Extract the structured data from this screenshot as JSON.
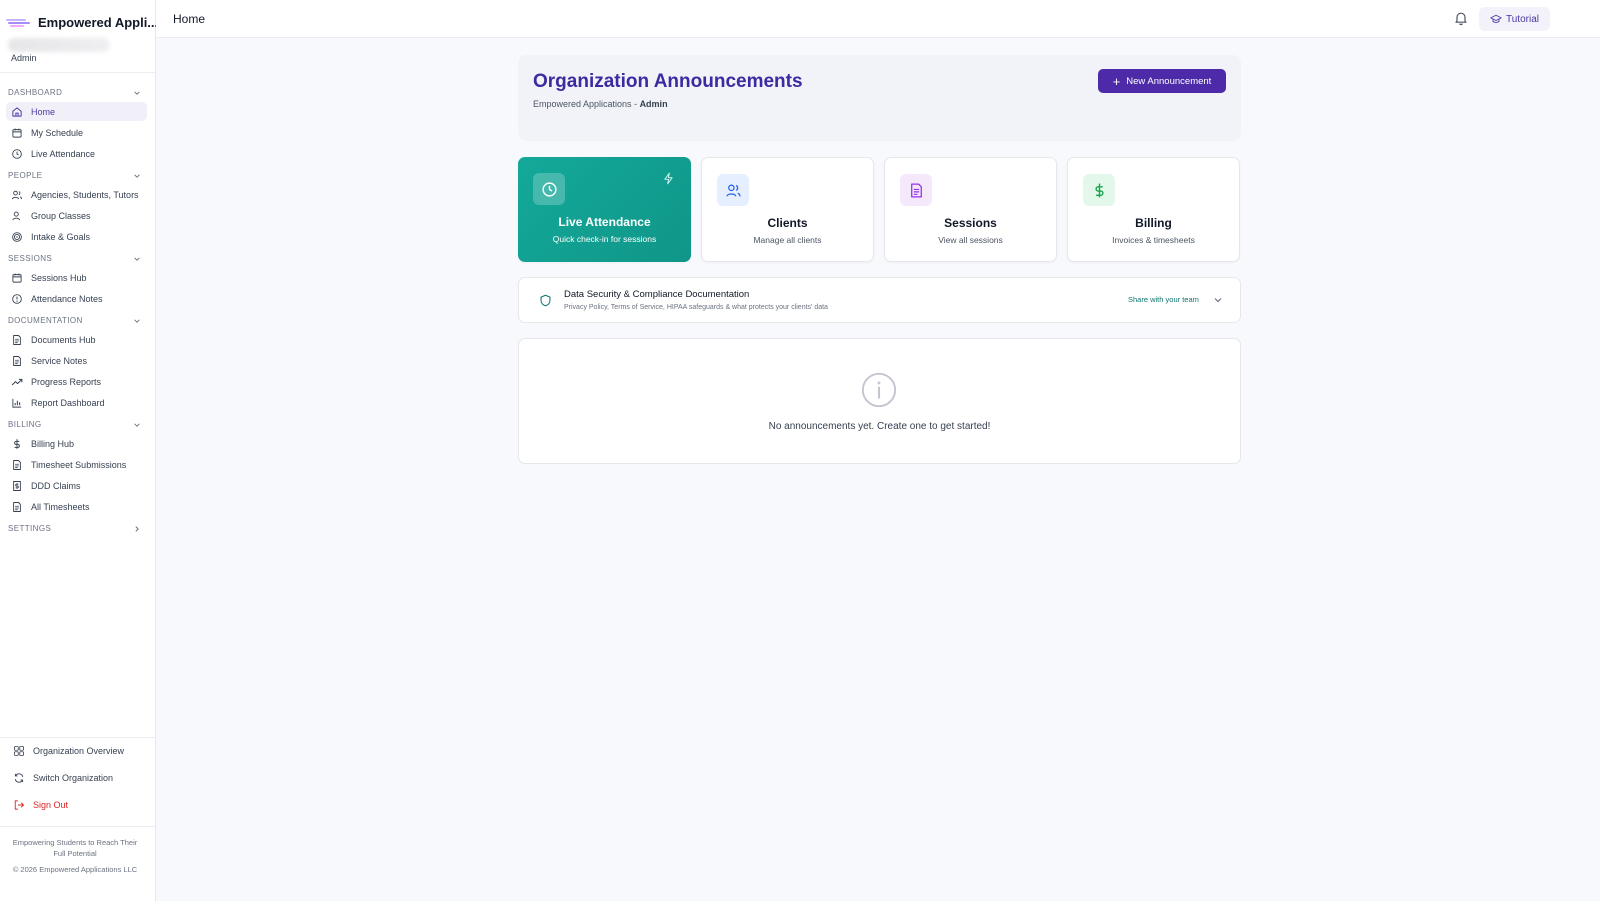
{
  "brand": {
    "name": "Empowered Appli..."
  },
  "user": {
    "role": "Admin"
  },
  "header": {
    "title": "Home",
    "tutorial_label": "Tutorial"
  },
  "sidebar": {
    "sections": [
      {
        "label": "DASHBOARD",
        "items": [
          "Home",
          "My Schedule",
          "Live Attendance"
        ]
      },
      {
        "label": "PEOPLE",
        "items": [
          "Agencies, Students, Tutors",
          "Group Classes",
          "Intake & Goals"
        ]
      },
      {
        "label": "SESSIONS",
        "items": [
          "Sessions Hub",
          "Attendance Notes"
        ]
      },
      {
        "label": "DOCUMENTATION",
        "items": [
          "Documents Hub",
          "Service Notes",
          "Progress Reports",
          "Report Dashboard"
        ]
      },
      {
        "label": "BILLING",
        "items": [
          "Billing Hub",
          "Timesheet Submissions",
          "DDD Claims",
          "All Timesheets"
        ]
      },
      {
        "label": "SETTINGS"
      }
    ],
    "bottom": [
      "Organization Overview",
      "Switch Organization",
      "Sign Out"
    ],
    "footer_tagline": "Empowering Students to Reach Their Full Potential",
    "footer_copyright": "© 2026 Empowered Applications LLC"
  },
  "announcements": {
    "title": "Organization Announcements",
    "org": "Empowered Applications",
    "sep": " - ",
    "role": "Admin",
    "new_button": "New Announcement",
    "empty_message": "No announcements yet. Create one to get started!"
  },
  "tiles": [
    {
      "title": "Live Attendance",
      "subtitle": "Quick check-in for sessions"
    },
    {
      "title": "Clients",
      "subtitle": "Manage all clients"
    },
    {
      "title": "Sessions",
      "subtitle": "View all sessions"
    },
    {
      "title": "Billing",
      "subtitle": "Invoices & timesheets"
    }
  ],
  "security": {
    "title": "Data Security & Compliance Documentation",
    "subtitle": "Privacy Policy, Terms of Service, HIPAA safeguards & what protects your clients' data",
    "share": "Share with your team"
  },
  "colors": {
    "primary": "#4c2aa8",
    "teal": "#14a99a",
    "danger": "#dc2626"
  }
}
